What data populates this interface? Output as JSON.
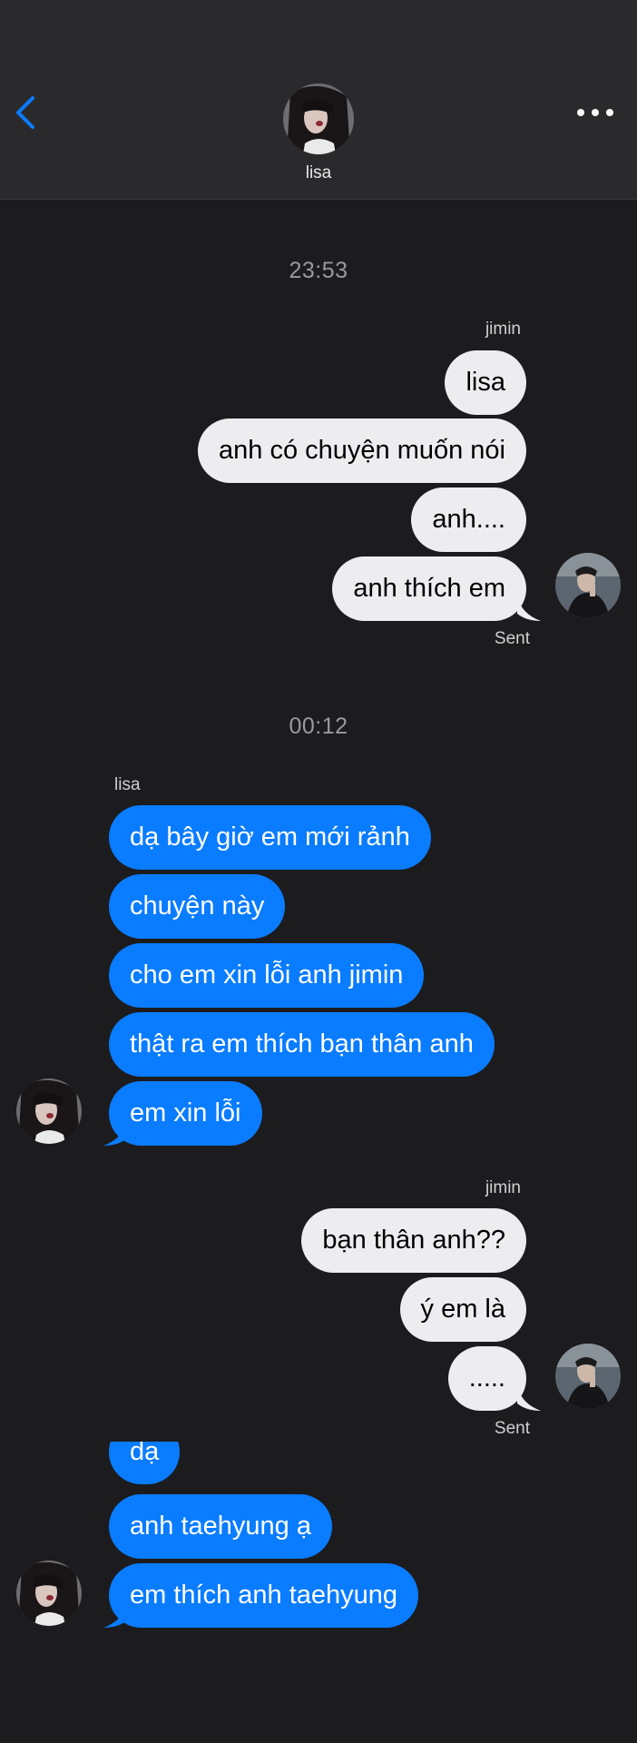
{
  "header": {
    "contact_name": "lisa",
    "back_icon": "chevron-left-icon",
    "more_icon": "more-icon",
    "accent": "#0a7cff"
  },
  "timestamps": [
    "23:53",
    "00:12"
  ],
  "groups": [
    {
      "sender": "jimin",
      "direction": "outgoing",
      "messages": [
        "lisa",
        "anh có chuyện muốn nói",
        "anh....",
        "anh thích em"
      ],
      "status": "Sent"
    },
    {
      "sender": "lisa",
      "direction": "incoming",
      "messages": [
        "dạ bây giờ em mới rảnh",
        "chuyện này",
        "cho em xin lỗi anh jimin",
        "thật ra em thích bạn thân anh",
        "em xin lỗi"
      ]
    },
    {
      "sender": "jimin",
      "direction": "outgoing",
      "messages": [
        "bạn thân anh??",
        "ý em là",
        "....."
      ],
      "status": "Sent"
    },
    {
      "direction": "incoming",
      "messages": [
        "dạ",
        "anh taehyung ạ",
        "em thích anh taehyung"
      ]
    }
  ],
  "colors": {
    "outgoing_bubble": "#ededf0",
    "incoming_bubble": "#0a7cff",
    "background": "#1c1c1e"
  }
}
